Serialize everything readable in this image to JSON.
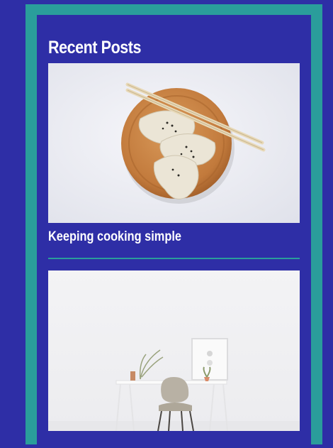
{
  "widget": {
    "title": "Recent Posts"
  },
  "posts": [
    {
      "title": "Keeping cooking simple",
      "image": "dumplings-on-wooden-plate-with-chopsticks"
    },
    {
      "title": "",
      "image": "minimal-white-desk-with-chair"
    }
  ],
  "colors": {
    "background": "#2e2ea6",
    "border": "#2a9d9b",
    "text": "#ffffff"
  }
}
